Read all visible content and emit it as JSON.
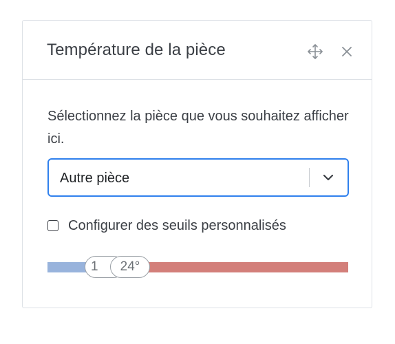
{
  "widget": {
    "title": "Température de la pièce",
    "icons": {
      "move": "move-arrows-icon",
      "close": "close-icon"
    }
  },
  "room_selector": {
    "description": "Sélectionnez la pièce que vous souhaitez afficher ici.",
    "selected": "Autre pièce",
    "chevron_icon": "chevron-down-icon"
  },
  "thresholds": {
    "checkbox_label": "Configurer des seuils personnalisés",
    "checked": false
  },
  "slider": {
    "low_label": "1",
    "high_label": "24°",
    "low_fraction": 0.19,
    "high_fraction": 0.275,
    "cold_color": "#98b3dc",
    "hot_color": "#d37f7a"
  }
}
